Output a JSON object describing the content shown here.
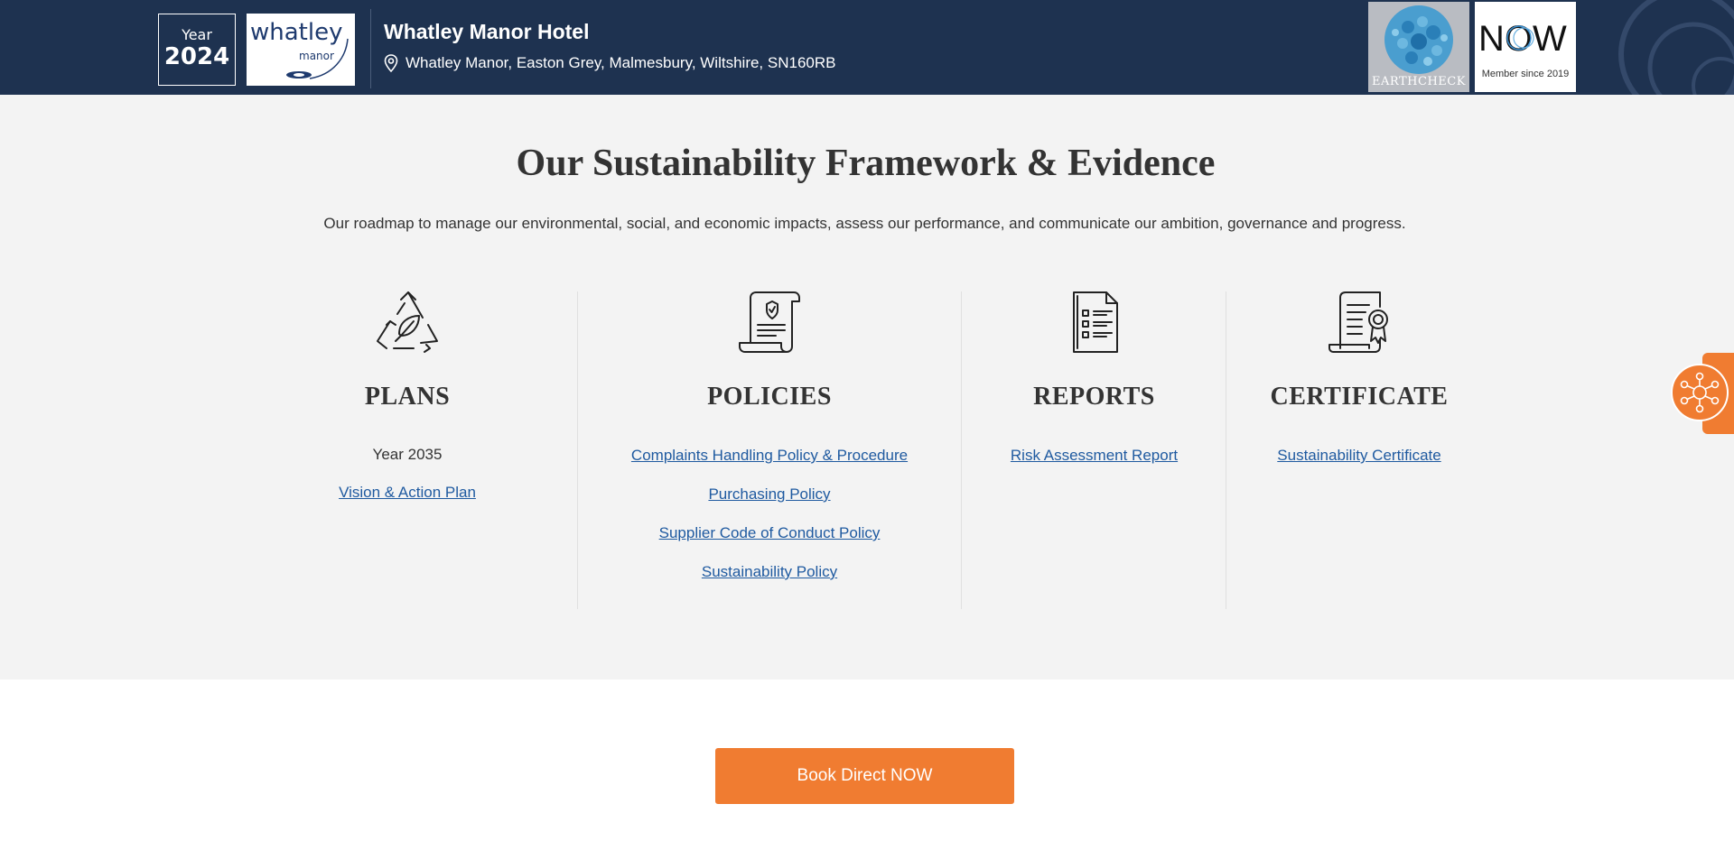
{
  "header": {
    "year_label": "Year",
    "year_value": "2024",
    "logo_word": "whatley",
    "logo_sub": "manor",
    "hotel_name": "Whatley Manor Hotel",
    "hotel_address": "Whatley Manor, Easton Grey, Malmesbury, Wiltshire, SN160RB",
    "earthcheck_label": "EARTHCHECK",
    "now_logo": "NOW",
    "now_member": "Member since 2019",
    "colors": {
      "background": "#1e3250",
      "text": "#ffffff"
    }
  },
  "main": {
    "title": "Our Sustainability Framework & Evidence",
    "subtitle": "Our roadmap to manage our environmental, social, and economic impacts, assess our performance, and communicate our ambition, governance and progress.",
    "columns": [
      {
        "icon": "recycle-leaf-icon",
        "heading": "PLANS",
        "text": "Year 2035",
        "links": [
          "Vision & Action Plan"
        ]
      },
      {
        "icon": "policy-scroll-icon",
        "heading": "POLICIES",
        "links": [
          "Complaints Handling Policy & Procedure",
          "Purchasing Policy",
          "Supplier Code of Conduct Policy",
          "Sustainability Policy"
        ]
      },
      {
        "icon": "report-document-icon",
        "heading": "REPORTS",
        "links": [
          "Risk Assessment Report"
        ]
      },
      {
        "icon": "certificate-icon",
        "heading": "CERTIFICATE",
        "links": [
          "Sustainability Certificate"
        ]
      }
    ]
  },
  "widget": {
    "icon": "network-hub-icon"
  },
  "cta": {
    "label": "Book Direct NOW"
  },
  "colors": {
    "accent": "#f07c31",
    "link": "#1f5aa0",
    "section_bg": "#f3f3f3",
    "text": "#333333"
  }
}
